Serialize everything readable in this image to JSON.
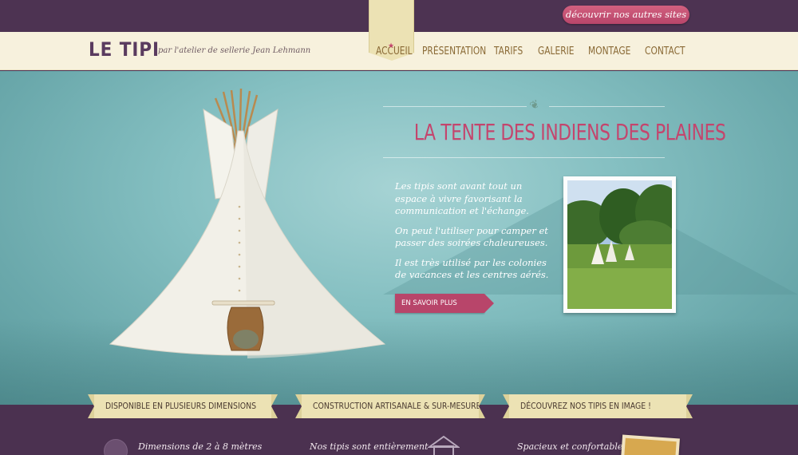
{
  "topbar": {
    "sites_button": "découvrir nos autres sites"
  },
  "header": {
    "logo": "LE TIPI",
    "tagline": "par l'atelier de sellerie Jean Lehmann"
  },
  "nav": {
    "items": [
      {
        "label": "ACCUEIL",
        "active": true
      },
      {
        "label": "PRÉSENTATION",
        "active": false
      },
      {
        "label": "TARIFS",
        "active": false
      },
      {
        "label": "GALERIE",
        "active": false
      },
      {
        "label": "MONTAGE",
        "active": false
      },
      {
        "label": "CONTACT",
        "active": false
      }
    ]
  },
  "hero": {
    "title": "LA TENTE DES INDIENS DES PLAINES",
    "paragraphs": [
      "Les tipis sont avant tout un espace à vivre favorisant la communication et l'échange.",
      "On peut l'utiliser pour camper et passer des soirées chaleureuses.",
      "Il est très utilisé par les colonies de vacances et les centres aérés."
    ],
    "button": "EN SAVOIR PLUS"
  },
  "features": [
    {
      "title": "DISPONIBLE EN PLUSIEURS DIMENSIONS",
      "text": "Dimensions de 2 à 8 mètres"
    },
    {
      "title": "CONSTRUCTION ARTISANALE & SUR-MESURE",
      "text": "Nos tipis sont entièrement"
    },
    {
      "title": "DÉCOUVREZ NOS TIPIS EN IMAGE !",
      "text": "Spacieux et confortable,"
    }
  ],
  "colors": {
    "accent": "#c4456d",
    "purple": "#4b3150",
    "cream": "#f7f1dd",
    "teal": "#84bfc1"
  },
  "icons": [
    "star-icon",
    "feather-icon",
    "ruler-icon",
    "house-icon"
  ]
}
